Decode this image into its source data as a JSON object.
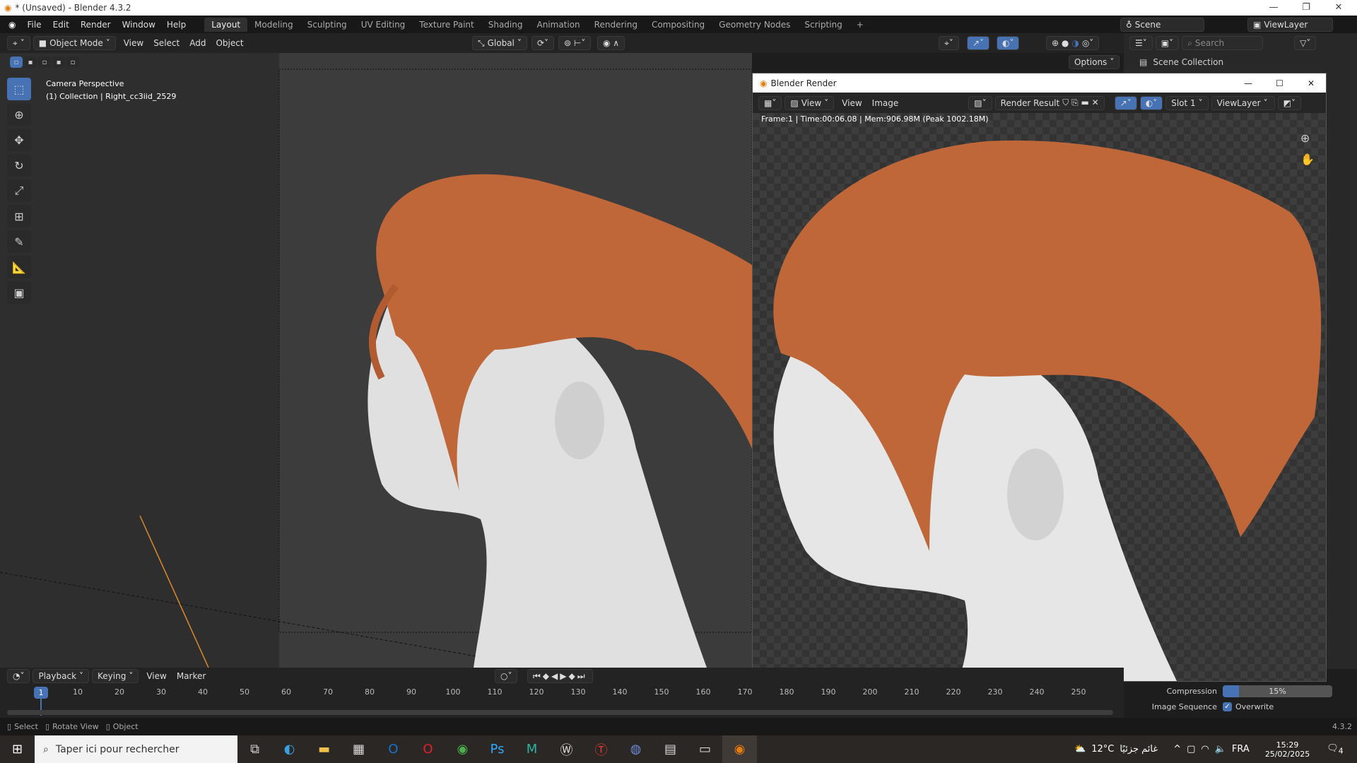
{
  "window": {
    "title": "* (Unsaved) - Blender 4.3.2"
  },
  "menu": [
    "File",
    "Edit",
    "Render",
    "Window",
    "Help"
  ],
  "workspaces": [
    "Layout",
    "Modeling",
    "Sculpting",
    "UV Editing",
    "Texture Paint",
    "Shading",
    "Animation",
    "Rendering",
    "Compositing",
    "Geometry Nodes",
    "Scripting",
    "+"
  ],
  "scene": {
    "name": "Scene",
    "view_layer": "ViewLayer"
  },
  "viewport_header": {
    "mode": "Object Mode",
    "items": [
      "View",
      "Select",
      "Add",
      "Object"
    ],
    "orientation": "Global",
    "options": "Options"
  },
  "viewport": {
    "camera_label": "Camera Perspective",
    "collection_label": "(1) Collection | Right_cc3iid_2529"
  },
  "outliner": {
    "search_placeholder": "Search",
    "root": "Scene Collection"
  },
  "render_window": {
    "title": "Blender Render",
    "view": "View",
    "menu": [
      "View",
      "Image"
    ],
    "image_name": "Render Result",
    "slot": "Slot 1",
    "layer": "ViewLayer",
    "info": "Frame:1 | Time:00:06.08 | Mem:906.98M (Peak 1002.18M)"
  },
  "properties": {
    "compression_label": "Compression",
    "compression_value": "15%",
    "compression_fraction": 0.15,
    "sequence_label": "Image Sequence",
    "overwrite_label": "Overwrite",
    "overwrite_checked": true
  },
  "timeline": {
    "menus": [
      "Playback",
      "Keying",
      "View",
      "Marker"
    ],
    "current_frame": "1",
    "ticks": [
      "10",
      "20",
      "30",
      "40",
      "50",
      "60",
      "70",
      "80",
      "90",
      "100",
      "110",
      "120",
      "130",
      "140",
      "150",
      "160",
      "170",
      "180",
      "190",
      "200",
      "210",
      "220",
      "230",
      "240",
      "250"
    ]
  },
  "statusbar": {
    "items": [
      "Select",
      "Rotate View",
      "Object"
    ],
    "version": "4.3.2"
  },
  "taskbar": {
    "search_placeholder": "Taper ici pour rechercher",
    "weather": "12°C",
    "weather_text": "غائم جزئيًا",
    "language": "FRA",
    "time": "15:29",
    "date": "25/02/2025",
    "notifications": "4"
  },
  "colors": {
    "accent": "#4772b3",
    "hair": "#c0673a",
    "skin": "#e4e4e4"
  }
}
